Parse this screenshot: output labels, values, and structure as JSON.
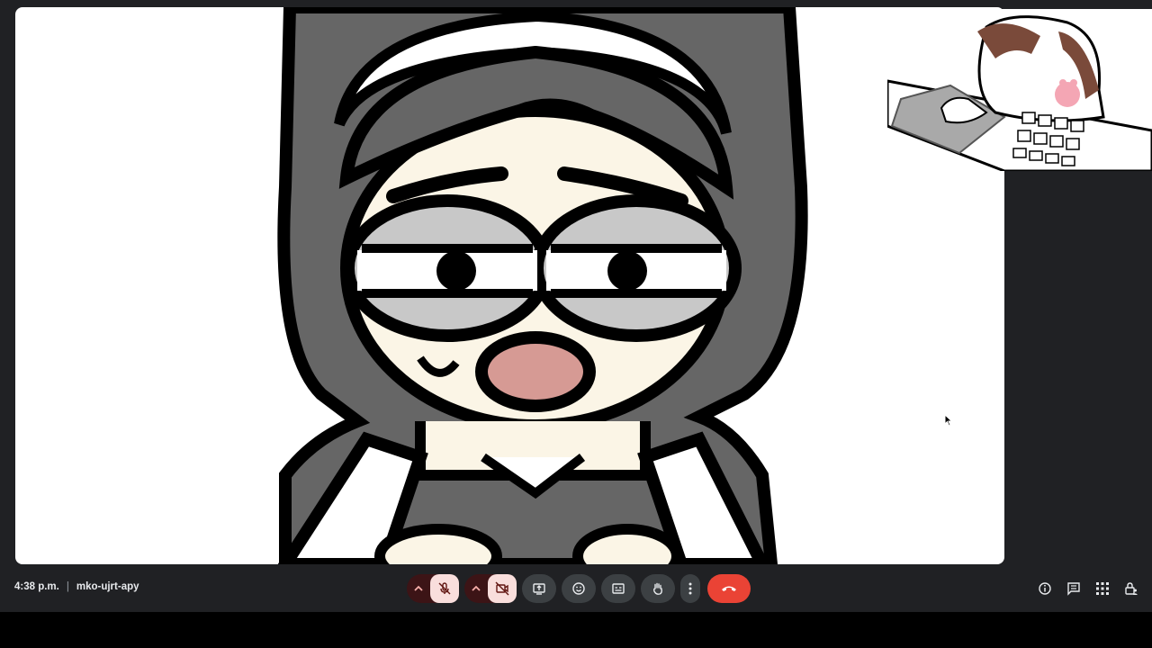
{
  "meeting": {
    "time": "4:38 p.m.",
    "separator": "|",
    "code": "mko-ujrt-apy"
  },
  "colors": {
    "background": "#202124",
    "control_button": "#3c4043",
    "muted_button": "#f9dedc",
    "end_call": "#ea4335",
    "muted_icon": "#c5221f"
  },
  "controls": [
    {
      "name": "audio-options",
      "icon": "chevron-up-icon"
    },
    {
      "name": "microphone",
      "icon": "mic-off-icon",
      "state": "off"
    },
    {
      "name": "video-options",
      "icon": "chevron-up-icon"
    },
    {
      "name": "camera",
      "icon": "videocam-off-icon",
      "state": "off"
    },
    {
      "name": "present",
      "icon": "present-screen-icon"
    },
    {
      "name": "reactions",
      "icon": "emoji-icon"
    },
    {
      "name": "captions",
      "icon": "closed-captions-icon"
    },
    {
      "name": "raise-hand",
      "icon": "hand-icon"
    },
    {
      "name": "more-options",
      "icon": "more-vert-icon"
    },
    {
      "name": "leave-call",
      "icon": "call-end-icon"
    }
  ],
  "side_controls": [
    {
      "name": "meeting-details",
      "icon": "info-icon"
    },
    {
      "name": "chat",
      "icon": "chat-icon"
    },
    {
      "name": "activities",
      "icon": "apps-grid-icon"
    },
    {
      "name": "host-controls",
      "icon": "lock-person-icon"
    }
  ],
  "participants": [
    {
      "tile": "main",
      "content": "cartoon-character-video"
    },
    {
      "tile": "pip",
      "content": "cat-at-keyboard-video"
    },
    {
      "tile": "side-1",
      "mic": "muted"
    },
    {
      "tile": "side-2",
      "mic": "muted"
    }
  ]
}
